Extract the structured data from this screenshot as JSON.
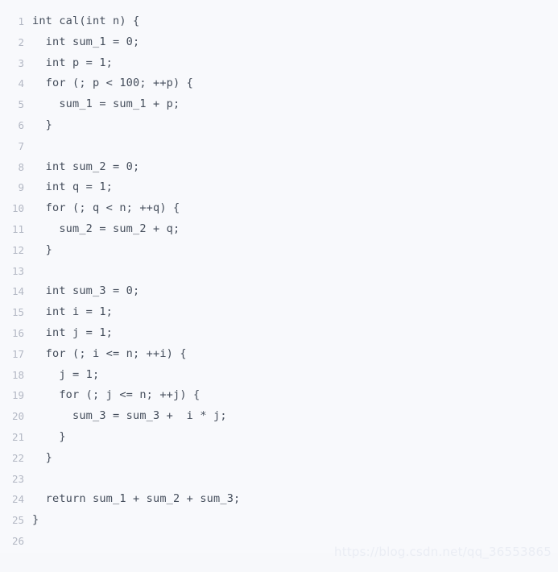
{
  "viewer": {
    "language": "c",
    "background_color": "#f8f9fc",
    "text_color": "#454e5c",
    "line_number_color": "#b3b8c4",
    "watermark_color": "#eaedf4"
  },
  "watermark": {
    "text": "https://blog.csdn.net/qq_36553865"
  },
  "code": {
    "lines": [
      {
        "number": "1",
        "text": "int cal(int n) {"
      },
      {
        "number": "2",
        "text": "  int sum_1 = 0;"
      },
      {
        "number": "3",
        "text": "  int p = 1;"
      },
      {
        "number": "4",
        "text": "  for (; p < 100; ++p) {"
      },
      {
        "number": "5",
        "text": "    sum_1 = sum_1 + p;"
      },
      {
        "number": "6",
        "text": "  }"
      },
      {
        "number": "7",
        "text": ""
      },
      {
        "number": "8",
        "text": "  int sum_2 = 0;"
      },
      {
        "number": "9",
        "text": "  int q = 1;"
      },
      {
        "number": "10",
        "text": "  for (; q < n; ++q) {"
      },
      {
        "number": "11",
        "text": "    sum_2 = sum_2 + q;"
      },
      {
        "number": "12",
        "text": "  }"
      },
      {
        "number": "13",
        "text": ""
      },
      {
        "number": "14",
        "text": "  int sum_3 = 0;"
      },
      {
        "number": "15",
        "text": "  int i = 1;"
      },
      {
        "number": "16",
        "text": "  int j = 1;"
      },
      {
        "number": "17",
        "text": "  for (; i <= n; ++i) {"
      },
      {
        "number": "18",
        "text": "    j = 1;"
      },
      {
        "number": "19",
        "text": "    for (; j <= n; ++j) {"
      },
      {
        "number": "20",
        "text": "      sum_3 = sum_3 +  i * j;"
      },
      {
        "number": "21",
        "text": "    }"
      },
      {
        "number": "22",
        "text": "  }"
      },
      {
        "number": "23",
        "text": ""
      },
      {
        "number": "24",
        "text": "  return sum_1 + sum_2 + sum_3;"
      },
      {
        "number": "25",
        "text": "}"
      },
      {
        "number": "26",
        "text": ""
      }
    ]
  }
}
